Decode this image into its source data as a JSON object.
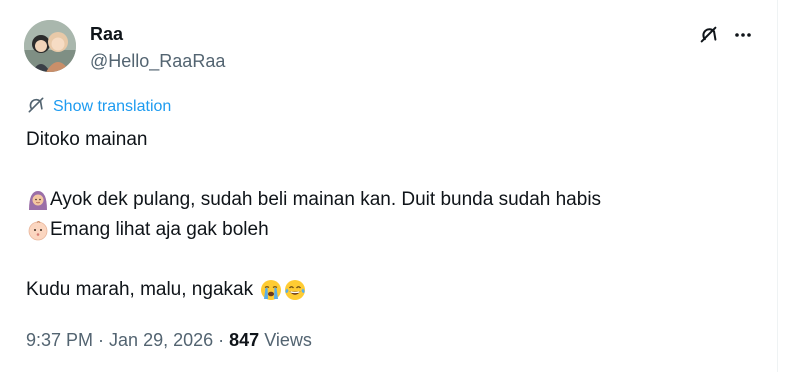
{
  "author": {
    "name": "Raa",
    "handle": "@Hello_RaaRaa"
  },
  "translate": {
    "label": "Show translation"
  },
  "tweet": {
    "line1": "Ditoko mainan",
    "line2": "Ayok dek pulang, sudah beli mainan kan. Duit bunda sudah habis",
    "line3": "Emang lihat aja gak boleh",
    "line4": "Kudu marah, malu, ngakak"
  },
  "meta": {
    "time": "9:37 PM",
    "sep1": " · ",
    "date": "Jan 29, 2026",
    "sep2": " · ",
    "views_count": "847",
    "views_label": " Views"
  },
  "icons": {
    "grok": "grok-icon",
    "more": "more-dots-icon",
    "translate": "translate-icon",
    "emoji_woman": "woman-with-headscarf-emoji",
    "emoji_baby": "baby-emoji",
    "emoji_cry": "loudly-crying-face-emoji",
    "emoji_joy": "face-with-tears-of-joy-emoji"
  },
  "colors": {
    "text": "#0f1419",
    "secondary": "#536471",
    "link": "#1d9bf0"
  }
}
